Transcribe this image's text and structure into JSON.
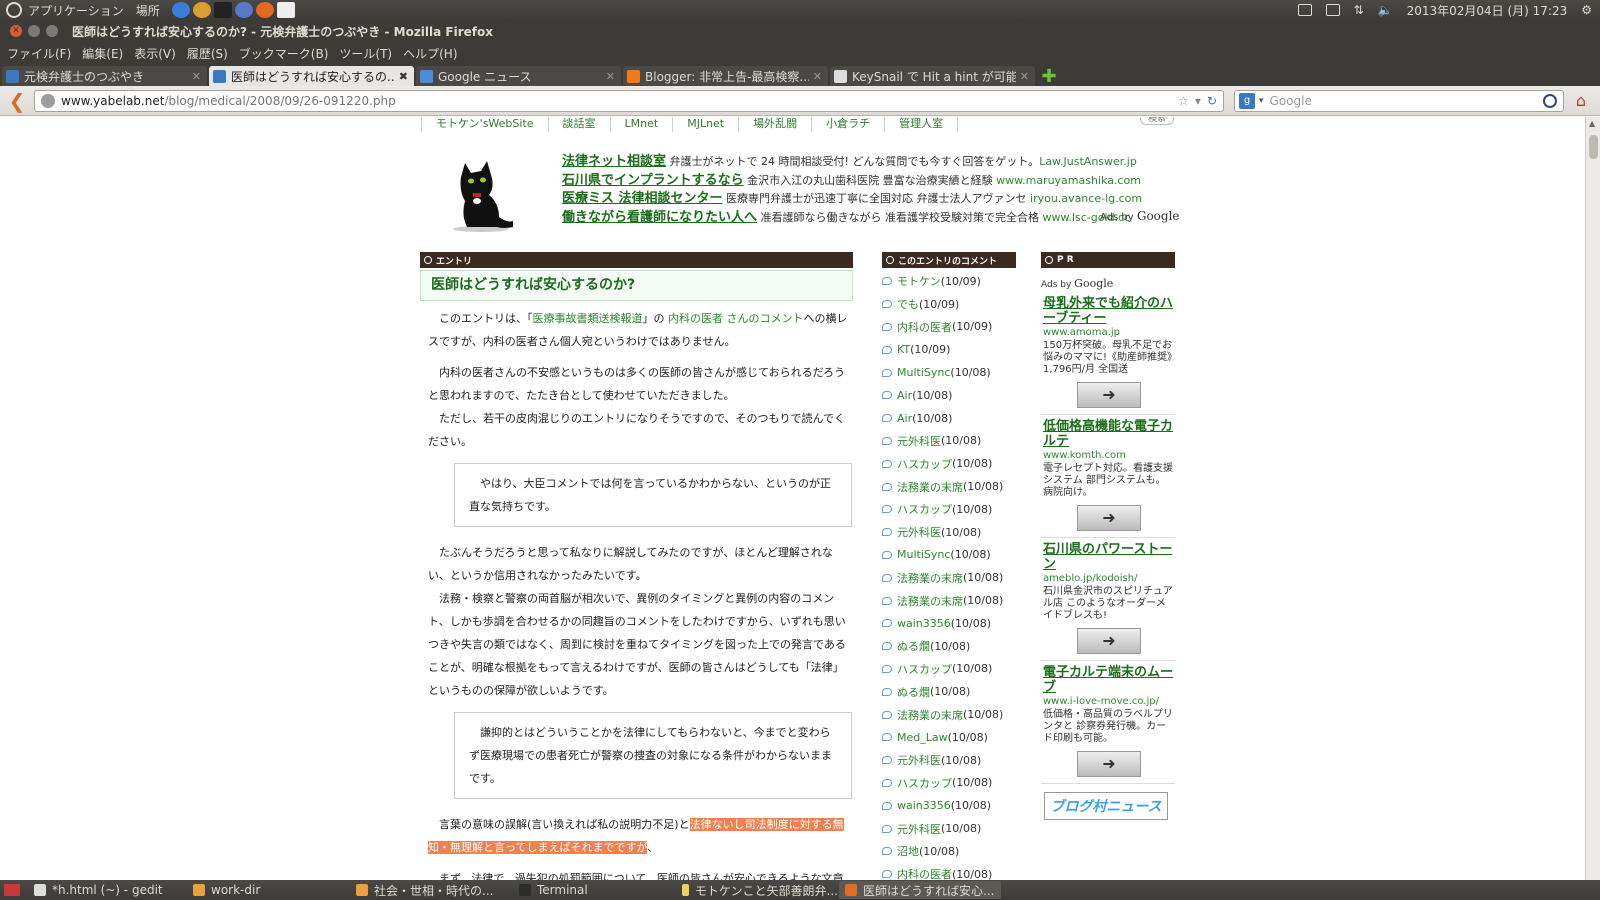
{
  "top_panel": {
    "menus": [
      "アプリケーション",
      "場所"
    ],
    "clock": "2013年02月04日 (月) 17:23"
  },
  "window": {
    "title": "医師はどうすれば安心するのか? - 元検弁護士のつぶやき - Mozilla Firefox"
  },
  "menubar": [
    "ファイル(F)",
    "編集(E)",
    "表示(V)",
    "履歴(S)",
    "ブックマーク(B)",
    "ツール(T)",
    "ヘルプ(H)"
  ],
  "tabs": [
    {
      "label": "元検弁護士のつぶやき",
      "color": "#3a78c4"
    },
    {
      "label": "医師はどうすれば安心するの...",
      "color": "#3a78c4"
    },
    {
      "label": "Google ニュース",
      "color": "#4a8cd8"
    },
    {
      "label": "Blogger: 非常上告-最高検察...",
      "color": "#f07a1a"
    },
    {
      "label": "KeySnail で Hit a hint が可能...",
      "color": "#dddddd"
    }
  ],
  "navbar": {
    "url_host": "www.yabelab.net",
    "url_path": "/blog/medical/2008/09/26-091220.php",
    "search_placeholder": "Google"
  },
  "site_nav": [
    "モトケン'sWebSite",
    "談話室",
    "LMnet",
    "MJLnet",
    "場外乱闘",
    "小倉ラチ",
    "管理人室"
  ],
  "search_tab_label": "検索",
  "top_ads": [
    {
      "title": "法律ネット相談室",
      "desc": " 弁護士がネットで 24 時間相談受付! どんな質問でも今すぐ回答をゲット。",
      "url": "Law.JustAnswer.jp"
    },
    {
      "title": "石川県でインプラントするなら",
      "desc": " 金沢市入江の丸山歯科医院 豊富な治療実績と経験 ",
      "url": "www.maruyamashika.com"
    },
    {
      "title": "医療ミス 法律相談センター",
      "desc": " 医療専門弁護士が迅速丁寧に全国対応 弁護士法人アヴァンセ ",
      "url": "iryou.avance-lg.com"
    },
    {
      "title": "働きながら看護師になりたい人へ",
      "desc": " 准看護師なら働きながら 准看護学校受験対策で完全合格 ",
      "url": "www.lsc-gold.cc"
    }
  ],
  "ads_by": {
    "prefix": "Ads by ",
    "brand": "Google"
  },
  "section_heads": {
    "entry": "エントリ",
    "comments": "このエントリのコメント",
    "pr": "P R"
  },
  "entry": {
    "title": "医師はどうすれば安心するのか?",
    "p1_a": "このエントリは、「",
    "p1_link1": "医療事故書類送検報道",
    "p1_b": "」の ",
    "p1_link2": "内科の医者 さんのコメント",
    "p1_c": "への横レスですが、内科の医者さん個人宛というわけではありません。",
    "p2": "内科の医者さんの不安感というものは多くの医師の皆さんが感じておられるだろうと思われますので、たたき台として使わせていただきました。",
    "p3": "ただし、若干の皮肉混じりのエントリになりそうですので、そのつもりで読んでください。",
    "quote1": "やはり、大臣コメントでは何を言っているかわからない、というのが正直な気持ちです。",
    "p4": "たぶんそうだろうと思って私なりに解説してみたのですが、ほとんど理解されない、というか信用されなかったみたいです。",
    "p5": "法務・検察と警察の両首脳が相次いで、異例のタイミングと異例の内容のコメント、しかも歩調を合わせるかの同趣旨のコメントをしたわけですから、いずれも思いつきや失言の類ではなく、周到に検討を重ねてタイミングを図った上での発言であることが、明確な根拠をもって言えるわけですが、医師の皆さんはどうしても「法律」というものの保障が欲しいようです。",
    "quote2": "謙抑的とはどういうことかを法律にしてもらわないと、今までと変わらず医療現場での患者死亡が警察の捜査の対象になる条件がわからないままです。",
    "p6_a": "言葉の意味の誤解(言い換えれば私の説明力不足)と",
    "p6_hl": "法律ないし司法制度に対する無知・無理解と言ってしまえばそれまでですが",
    "p6_b": "、",
    "p7": "まず、法律で、過失犯の処罰範囲について、医師の皆さんが安心できるような文章表現でその限界を示すことは、至難の業です。"
  },
  "comments": [
    {
      "name": "モトケン",
      "date": "(10/09)"
    },
    {
      "name": "でも",
      "date": "(10/09)"
    },
    {
      "name": "内科の医者",
      "date": "(10/09)"
    },
    {
      "name": "KT",
      "date": "(10/09)"
    },
    {
      "name": "MultiSync",
      "date": "(10/08)"
    },
    {
      "name": "Air",
      "date": "(10/08)"
    },
    {
      "name": "Air",
      "date": "(10/08)"
    },
    {
      "name": "元外科医",
      "date": "(10/08)"
    },
    {
      "name": "ハスカップ",
      "date": "(10/08)"
    },
    {
      "name": "法務業の末席",
      "date": "(10/08)"
    },
    {
      "name": "ハスカップ",
      "date": "(10/08)"
    },
    {
      "name": "元外科医",
      "date": "(10/08)"
    },
    {
      "name": "MultiSync",
      "date": "(10/08)"
    },
    {
      "name": "法務業の末席",
      "date": "(10/08)"
    },
    {
      "name": "法務業の末席",
      "date": "(10/08)"
    },
    {
      "name": "wain3356",
      "date": "(10/08)"
    },
    {
      "name": "ぬる燗",
      "date": "(10/08)"
    },
    {
      "name": "ハスカップ",
      "date": "(10/08)"
    },
    {
      "name": "ぬる燗",
      "date": "(10/08)"
    },
    {
      "name": "法務業の末席",
      "date": "(10/08)"
    },
    {
      "name": "Med_Law",
      "date": "(10/08)"
    },
    {
      "name": "元外科医",
      "date": "(10/08)"
    },
    {
      "name": "ハスカップ",
      "date": "(10/08)"
    },
    {
      "name": "wain3356",
      "date": "(10/08)"
    },
    {
      "name": "元外科医",
      "date": "(10/08)"
    },
    {
      "name": "沼地",
      "date": "(10/08)"
    },
    {
      "name": "内科の医者",
      "date": "(10/08)"
    }
  ],
  "pr_ads": [
    {
      "title": "母乳外来でも紹介のハーブティー",
      "url": "www.amoma.jp",
      "desc": "150万杯突破。母乳不足でお悩みのママに!《助産師推奨》1,796円/月 全国送"
    },
    {
      "title": "低価格高機能な電子カルテ",
      "url": "www.komth.com",
      "desc": "電子レセプト対応。看護支援システム 部門システムも。病院向け。"
    },
    {
      "title": "石川県のパワーストーン",
      "url": "ameblo.jp/kodoish/",
      "desc": "石川県金沢市のスピリチュアル店 このようなオーダーメイドブレスも!"
    },
    {
      "title": "電子カルテ端末のムーブ",
      "url": "www.i-love-move.co.jp/",
      "desc": "低価格・高品質のラベルプリンタと 診察券発行機。カード印刷も可能。"
    }
  ],
  "pr_go": "➜",
  "blogmura": "ブログ村ニュース",
  "taskbar": [
    {
      "label": "*h.html (~) - gedit",
      "color": "#dddddd"
    },
    {
      "label": "work-dir",
      "color": "#e8a040"
    },
    {
      "label": "社会・世相・時代の...",
      "color": "#e8a040"
    },
    {
      "label": "Terminal",
      "color": "#2c2c2c"
    },
    {
      "label": "モトケンこと矢部善朗弁...",
      "color": "#f0d060"
    },
    {
      "label": "医師はどうすれば安心...",
      "color": "#e86a20"
    }
  ]
}
